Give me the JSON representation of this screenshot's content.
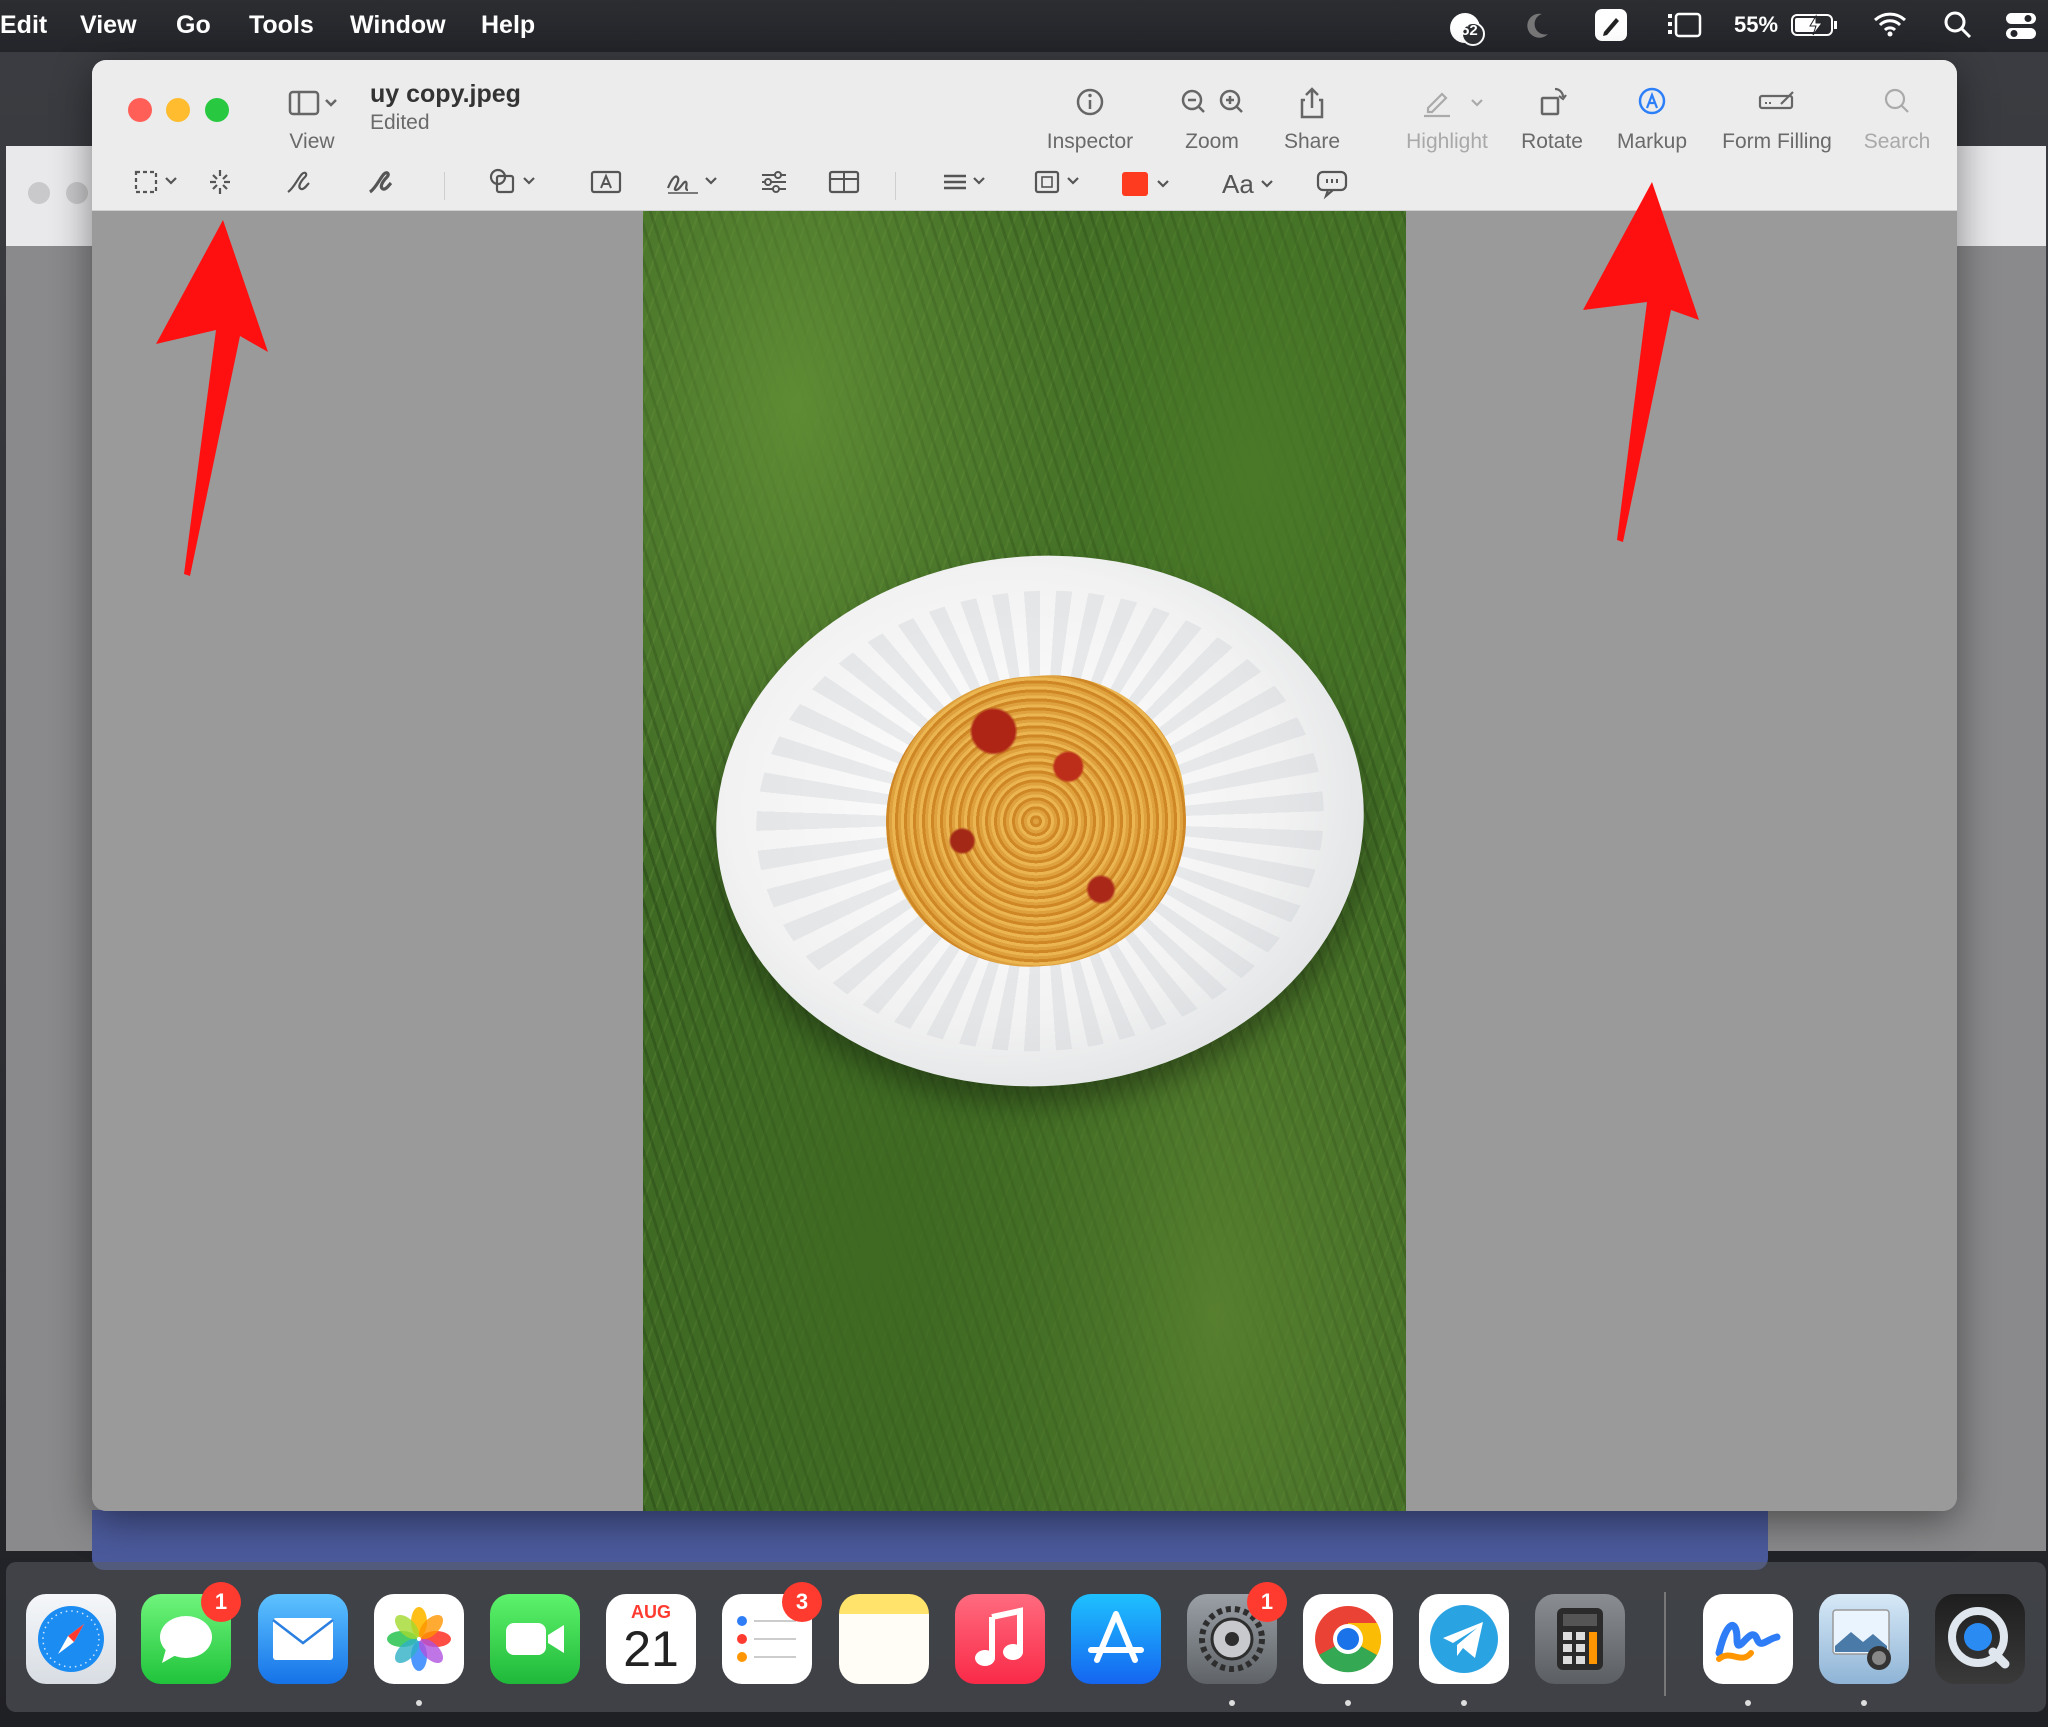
{
  "menubar": {
    "items": [
      "Edit",
      "View",
      "Go",
      "Tools",
      "Window",
      "Help"
    ],
    "status": {
      "notifications": "52",
      "battery": "55%"
    }
  },
  "window": {
    "title": "uy copy.jpeg",
    "subtitle": "Edited",
    "toolbar": {
      "view": "View",
      "inspector": "Inspector",
      "zoom": "Zoom",
      "share": "Share",
      "highlight": "Highlight",
      "rotate": "Rotate",
      "markup": "Markup",
      "form_filling": "Form Filling",
      "search": "Search"
    },
    "markup_bar": {
      "text_style": "Aa",
      "color": "#ff3b1f"
    }
  },
  "dock": {
    "calendar": {
      "month": "AUG",
      "day": "21"
    },
    "badges": {
      "messages": "1",
      "reminders": "3",
      "settings": "1"
    }
  },
  "colors": {
    "arrow": "#ff1010",
    "markup_active": "#2d7ff9"
  }
}
